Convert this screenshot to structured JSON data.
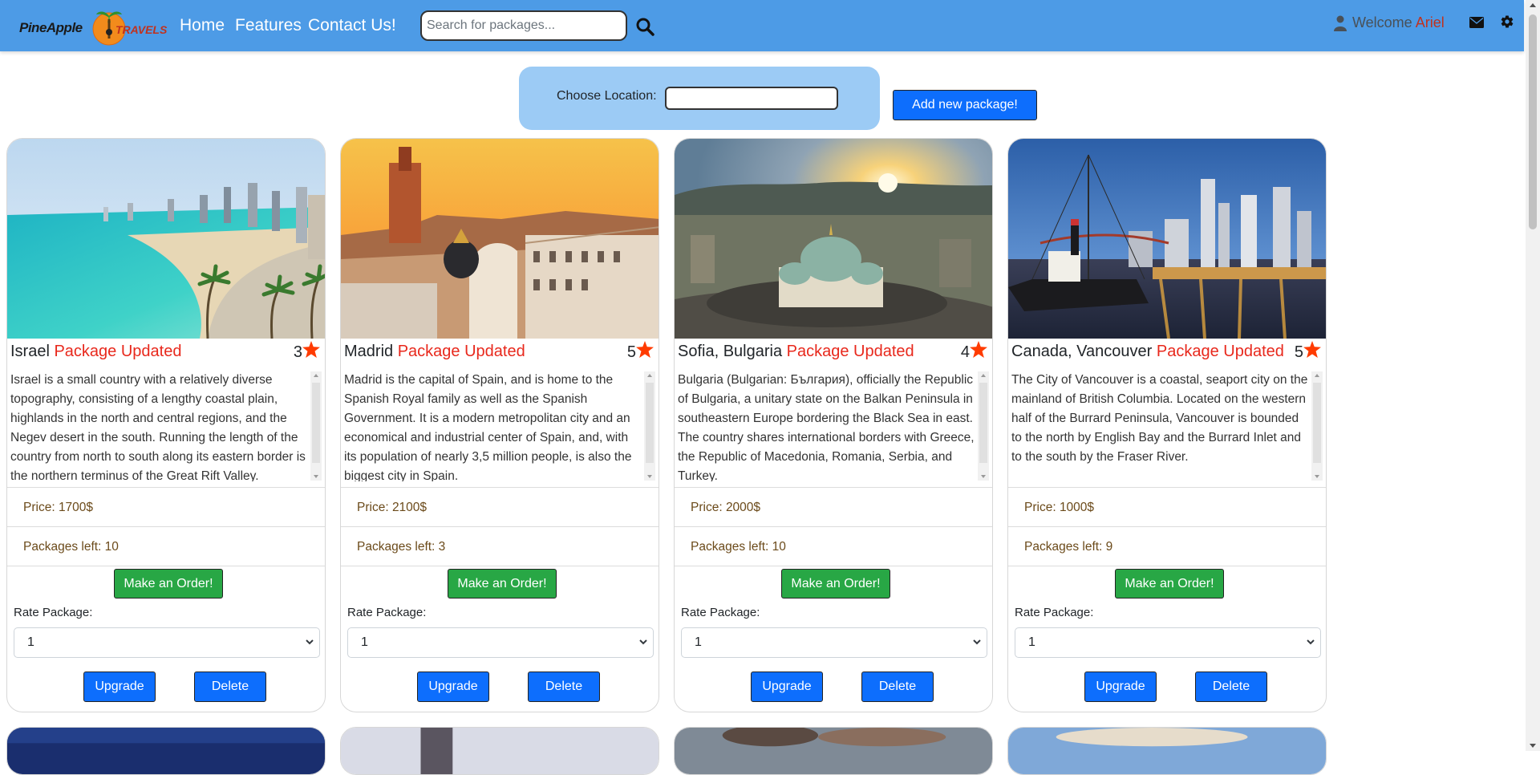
{
  "app": {
    "logo_text_a": "PineApple",
    "logo_text_b": "Travels"
  },
  "nav": {
    "links": [
      "Home",
      "Features",
      "Contact Us!"
    ],
    "search_placeholder": "Search for packages...",
    "welcome_text": "Welcome",
    "username": "Ariel"
  },
  "filter": {
    "location_label": "Choose Location:",
    "location_value": "",
    "add_button": "Add new package!"
  },
  "labels": {
    "order_button": "Make an Order!",
    "rate_label": "Rate Package:",
    "upgrade_button": "Upgrade",
    "delete_button": "Delete",
    "price_prefix": "Price: ",
    "left_prefix": "Packages left: "
  },
  "packages": [
    {
      "name": "Israel",
      "status": "Package Updated",
      "rating": "3",
      "description": "Israel is a small country with a relatively diverse topography, consisting of a lengthy coastal plain, highlands in the north and central regions, and the Negev desert in the south. Running the length of the country from north to south along its eastern border is the northern terminus of the Great Rift Valley.",
      "price": "1700$",
      "packages_left": "10",
      "rate_value": "1"
    },
    {
      "name": "Madrid",
      "status": "Package Updated",
      "rating": "5",
      "description": "Madrid is the capital of Spain, and is home to the Spanish Royal family as well as the Spanish Government. It is a modern metropolitan city and an economical and industrial center of Spain, and, with its population of nearly 3,5 million people, is also the biggest city in Spain.",
      "price": "2100$",
      "packages_left": "3",
      "rate_value": "1"
    },
    {
      "name": "Sofia, Bulgaria",
      "status": "Package Updated",
      "rating": "4",
      "description": "Bulgaria (Bulgarian: България), officially the Republic of Bulgaria, a unitary state on the Balkan Peninsula in southeastern Europe bordering the Black Sea in east. The country shares international borders with Greece, the Republic of Macedonia, Romania, Serbia, and Turkey.",
      "price": "2000$",
      "packages_left": "10",
      "rate_value": "1"
    },
    {
      "name": "Canada, Vancouver",
      "status": "Package Updated",
      "rating": "5",
      "description": "The City of Vancouver is a coastal, seaport city on the mainland of British Columbia. Located on the western half of the Burrard Peninsula, Vancouver is bounded to the north by English Bay and the Burrard Inlet and to the south by the Fraser River.",
      "price": "1000$",
      "packages_left": "9",
      "rate_value": "1"
    }
  ],
  "icons": {
    "logo": "pineapple-logo-icon",
    "search": "search-icon",
    "user": "user-icon",
    "mail": "envelope-icon",
    "settings": "gear-icon",
    "star": "star-icon",
    "chevron": "chevron-down-icon"
  },
  "colors": {
    "navbar": "#4d9be6",
    "accent_red": "#e8281c",
    "primary": "#0d6efd",
    "success": "#28a745",
    "location_panel": "#9ccbf5",
    "star": "#ff3b00"
  }
}
